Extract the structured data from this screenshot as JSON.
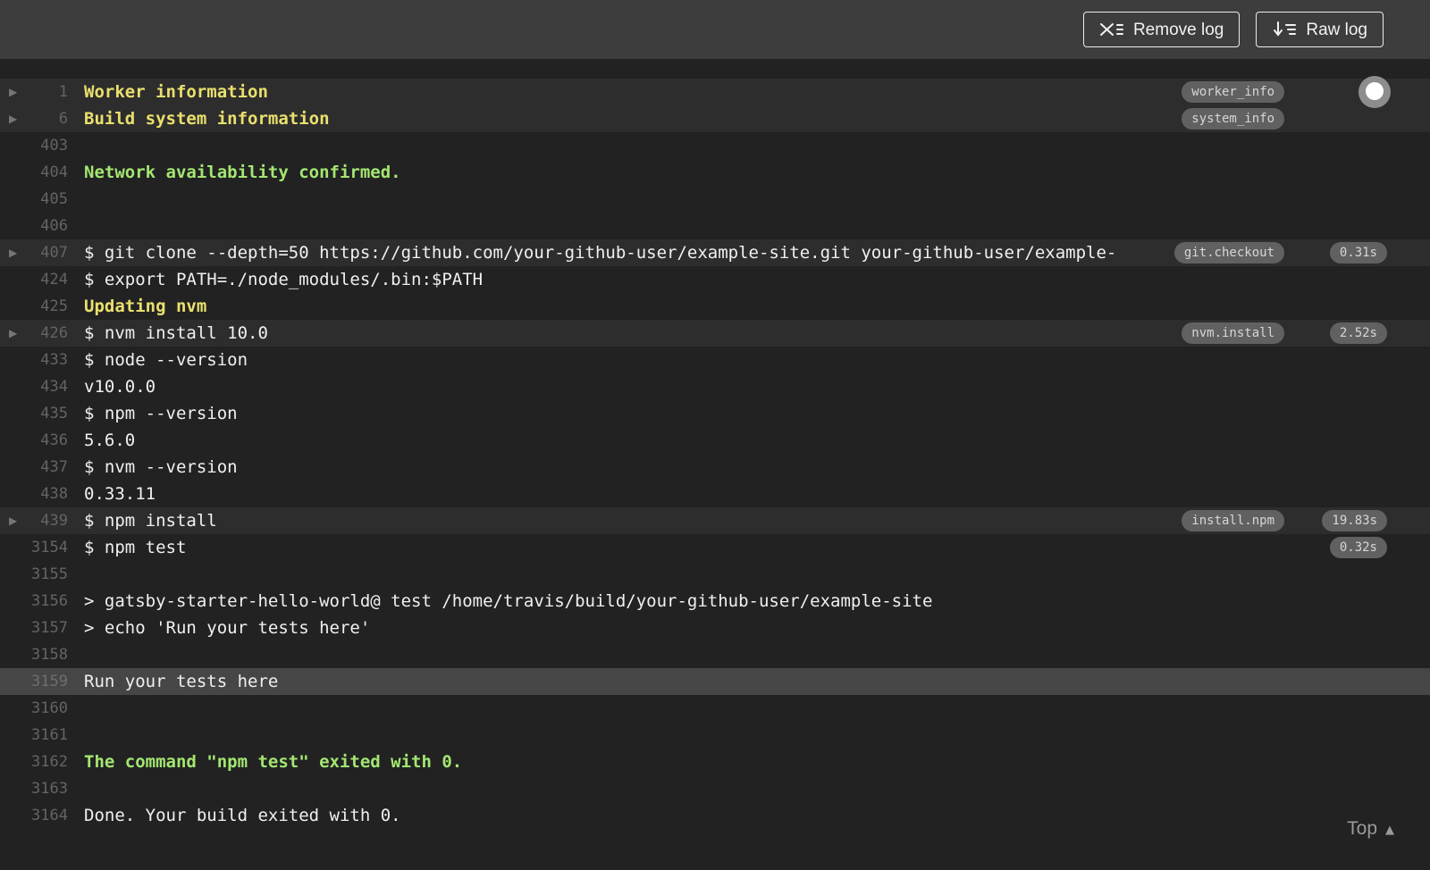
{
  "header": {
    "buttons": [
      {
        "label": "Remove log",
        "icon": "remove-log-icon"
      },
      {
        "label": "Raw log",
        "icon": "raw-log-icon"
      }
    ]
  },
  "colors": {
    "topbar_bg": "#3d3d3d",
    "log_bg": "#222222",
    "fold_row_bg": "#2e2d2d",
    "selected_row_bg": "#464646",
    "yellow_text": "#e9e06e",
    "green_text": "#a3e671",
    "default_text": "#f0f0f0",
    "line_number": "#646464",
    "badge_bg": "#616161"
  },
  "log": {
    "lines": [
      {
        "num": "1",
        "text": "Worker information",
        "style": "yellow",
        "fold": true,
        "header": true,
        "badge": "worker_info",
        "knob": true
      },
      {
        "num": "6",
        "text": "Build system information",
        "style": "yellow",
        "fold": true,
        "header": true,
        "badge": "system_info"
      },
      {
        "num": "403",
        "text": ""
      },
      {
        "num": "404",
        "text": "Network availability confirmed.",
        "style": "green"
      },
      {
        "num": "405",
        "text": ""
      },
      {
        "num": "406",
        "text": ""
      },
      {
        "num": "407",
        "text": "$ git clone --depth=50 https://github.com/your-github-user/example-site.git your-github-user/example-",
        "fold": true,
        "header": true,
        "badge": "git.checkout",
        "duration": "0.31s"
      },
      {
        "num": "424",
        "text": "$ export PATH=./node_modules/.bin:$PATH"
      },
      {
        "num": "425",
        "text": "Updating nvm",
        "style": "yellow"
      },
      {
        "num": "426",
        "text": "$ nvm install 10.0",
        "fold": true,
        "header": true,
        "badge": "nvm.install",
        "duration": "2.52s"
      },
      {
        "num": "433",
        "text": "$ node --version"
      },
      {
        "num": "434",
        "text": "v10.0.0"
      },
      {
        "num": "435",
        "text": "$ npm --version"
      },
      {
        "num": "436",
        "text": "5.6.0"
      },
      {
        "num": "437",
        "text": "$ nvm --version"
      },
      {
        "num": "438",
        "text": "0.33.11"
      },
      {
        "num": "439",
        "text": "$ npm install",
        "fold": true,
        "header": true,
        "badge": "install.npm",
        "duration": "19.83s"
      },
      {
        "num": "3154",
        "text": "$ npm test",
        "duration": "0.32s"
      },
      {
        "num": "3155",
        "text": ""
      },
      {
        "num": "3156",
        "text": "> gatsby-starter-hello-world@ test /home/travis/build/your-github-user/example-site"
      },
      {
        "num": "3157",
        "text": "> echo 'Run your tests here'"
      },
      {
        "num": "3158",
        "text": ""
      },
      {
        "num": "3159",
        "text": "Run your tests here",
        "selected": true
      },
      {
        "num": "3160",
        "text": ""
      },
      {
        "num": "3161",
        "text": ""
      },
      {
        "num": "3162",
        "text": "The command \"npm test\" exited with 0.",
        "style": "green"
      },
      {
        "num": "3163",
        "text": ""
      },
      {
        "num": "3164",
        "text": "Done. Your build exited with 0."
      }
    ],
    "top_link_label": "Top"
  }
}
